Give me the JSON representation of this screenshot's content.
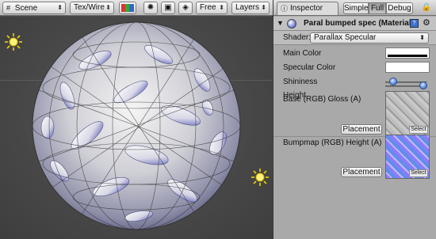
{
  "scene": {
    "toolbar": {
      "view_dropdown": "Scene",
      "render_mode": "Tex/Wire",
      "camera_mode": "Free",
      "layers": "Layers"
    },
    "icons": [
      "grid-icon",
      "rgb-channels-icon",
      "sun-toggle-icon",
      "image-toggle-icon",
      "audio-cube-icon",
      "light-icon"
    ]
  },
  "inspector": {
    "tab_label": "Inspector",
    "modes": [
      "Simple",
      "Full",
      "Debug"
    ],
    "active_mode": "Full",
    "material_title": "Paral bumped spec (Material)",
    "shader_label": "Shader:",
    "shader_value": "Parallax Specular",
    "properties": {
      "main_color": {
        "label": "Main Color",
        "value": "#ffffff"
      },
      "specular_color": {
        "label": "Specular Color",
        "value": "#ffffff"
      },
      "shininess": {
        "label": "Shininess",
        "value": 0.2
      },
      "height": {
        "label": "Height",
        "value": 0.93
      },
      "base": {
        "label": "Base (RGB) Gloss (A)",
        "placement": "Placement",
        "select": "Select"
      },
      "bumpmap": {
        "label": "Bumpmap (RGB) Height (A)",
        "placement": "Placement",
        "select": "Select"
      }
    }
  },
  "colors": {
    "accent": "#3d6fd0",
    "scene_bg": "#4a4a4a",
    "inspector_bg": "#a9a9a9"
  }
}
